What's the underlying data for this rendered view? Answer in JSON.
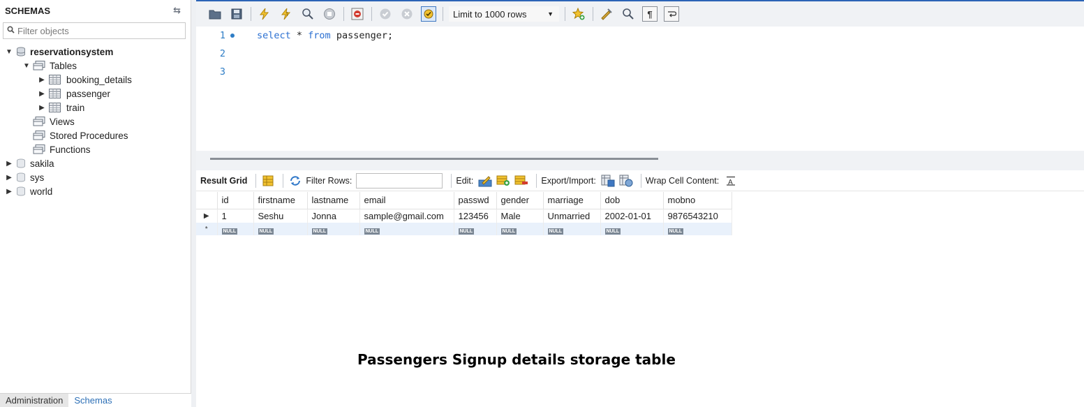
{
  "schemas_panel": {
    "title": "SCHEMAS",
    "filter_placeholder": "Filter objects",
    "tree": {
      "db_name": "reservationsystem",
      "tables_label": "Tables",
      "tables": [
        "booking_details",
        "passenger",
        "train"
      ],
      "views_label": "Views",
      "procedures_label": "Stored Procedures",
      "functions_label": "Functions",
      "other_dbs": [
        "sakila",
        "sys",
        "world"
      ]
    },
    "tabs": {
      "administration": "Administration",
      "schemas": "Schemas"
    }
  },
  "toolbar": {
    "limit_label": "Limit to 1000 rows"
  },
  "editor": {
    "line_numbers": [
      "1",
      "2",
      "3"
    ],
    "query": {
      "kw1": "select",
      "star": " * ",
      "kw2": "from",
      "rest": " passenger;"
    }
  },
  "result_bar": {
    "result_grid": "Result Grid",
    "filter_rows": "Filter Rows:",
    "edit": "Edit:",
    "export_import": "Export/Import:",
    "wrap_cell": "Wrap Cell Content:"
  },
  "grid": {
    "columns": [
      "id",
      "firstname",
      "lastname",
      "email",
      "passwd",
      "gender",
      "marriage",
      "dob",
      "mobno"
    ],
    "rows": [
      [
        "1",
        "Seshu",
        "Jonna",
        "sample@gmail.com",
        "123456",
        "Male",
        "Unmarried",
        "2002-01-01",
        "9876543210"
      ]
    ],
    "null_label": "NULL",
    "new_row_marker": "*"
  },
  "caption": "Passengers Signup details storage table",
  "colors": {
    "accent_blue": "#2b63b6",
    "keyword_blue": "#2a6fd1",
    "null_badge": "#7b8794",
    "null_row_bg": "#e9f1fb"
  }
}
